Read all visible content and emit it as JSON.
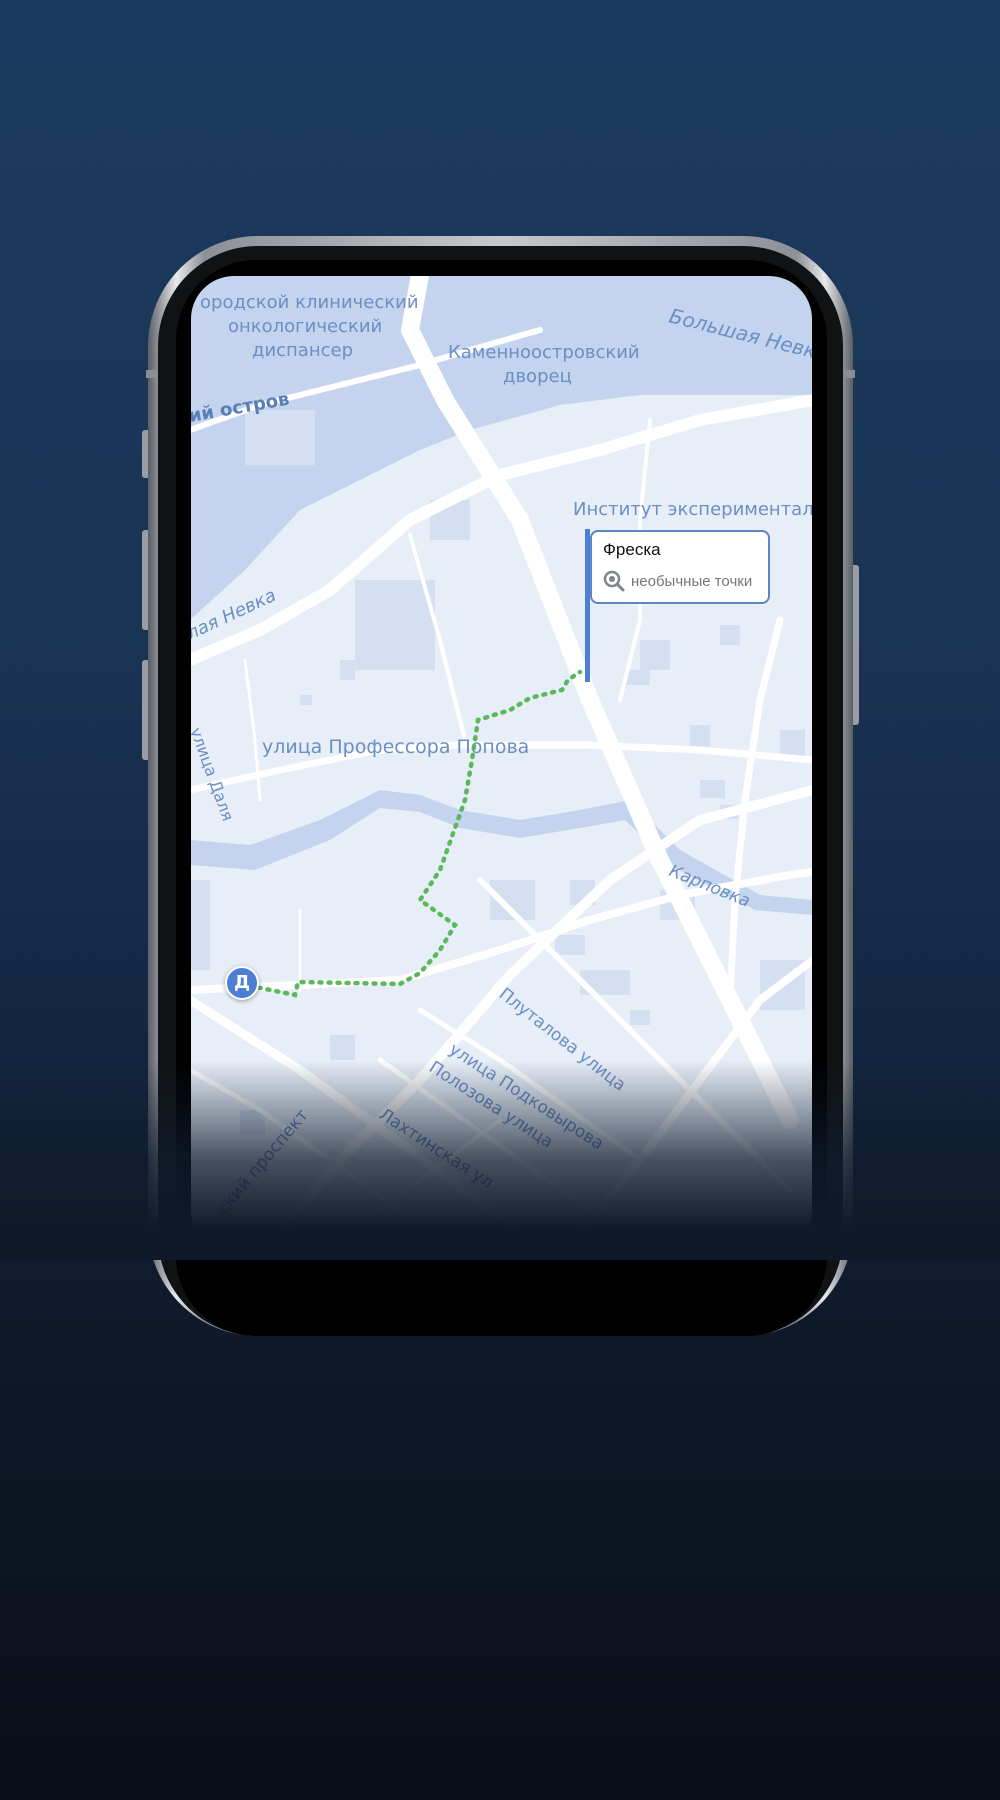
{
  "map": {
    "labels": {
      "oncology": [
        "ородской клинический",
        "онкологический",
        "диспансер"
      ],
      "palace": [
        "Каменноостровский",
        "дворец"
      ],
      "bolshaya_nevka": "Большая Невка",
      "island": "ий остров",
      "institute": "Институт экспериментальн",
      "malaya_nevka": "лая Невка",
      "prof_popova": "улица Профессора Попова",
      "dalya": "улица Даля",
      "karpovka": "Карповка",
      "plutalova": "Плуталова улица",
      "podkovyrova": "улица Подковырова",
      "polozova": "Полозова улица",
      "lakhtinskaya": "Лахтинская ул",
      "prospekt": "ский проспект"
    },
    "poi": {
      "title": "Фреска",
      "category": "необычные точки",
      "icon": "magnifier-icon"
    },
    "start_marker": {
      "letter": "Д",
      "color": "#4c7fd3"
    },
    "route_color": "#5cb85c",
    "water_color": "#c4d4ee",
    "land_color": "#e7eef8"
  }
}
